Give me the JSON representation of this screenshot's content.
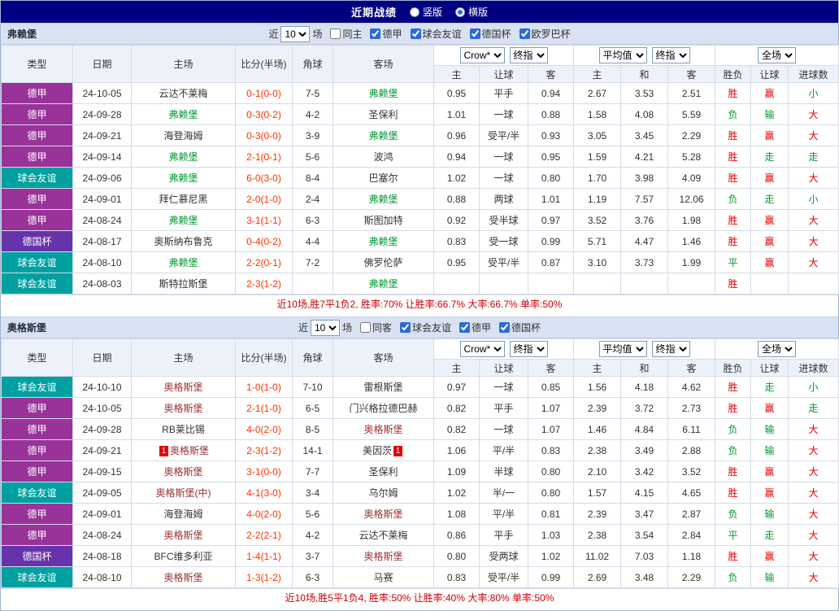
{
  "topbar": {
    "title": "近期战绩",
    "options": [
      {
        "label": "竖版",
        "selected": false
      },
      {
        "label": "横版",
        "selected": true
      }
    ]
  },
  "colors": {
    "topbar_bg": "#000080",
    "win": "#e60000",
    "loss": "#009933",
    "score": "#ff3300",
    "summary": "#cc0000",
    "league": {
      "德甲": "#993399",
      "球会友谊": "#00a0a0",
      "德国杯": "#6633aa"
    }
  },
  "result_win_values": [
    "胜",
    "赢",
    "大"
  ],
  "columns": {
    "main": [
      "类型",
      "日期",
      "主场",
      "比分(半场)",
      "角球",
      "客场"
    ],
    "asia_sub": [
      "主",
      "让球",
      "客"
    ],
    "europe_sub": [
      "主",
      "和",
      "客"
    ],
    "result_sub": [
      "胜负",
      "让球",
      "进球数"
    ]
  },
  "sections": [
    {
      "team": "弗赖堡",
      "focus_color": "#009933",
      "filter": {
        "recent_prefix": "近",
        "recent_count": "10",
        "recent_suffix": "场",
        "checkboxes": [
          {
            "label": "同主",
            "checked": false
          },
          {
            "label": "德甲",
            "checked": true
          },
          {
            "label": "球会友谊",
            "checked": true
          },
          {
            "label": "德国杯",
            "checked": true
          },
          {
            "label": "欧罗巴杯",
            "checked": true
          }
        ]
      },
      "dropdowns": {
        "asia": [
          "Crow*",
          "终指"
        ],
        "europe": [
          "平均值",
          "终指"
        ],
        "result": [
          "全场"
        ]
      },
      "rows": [
        {
          "league": "德甲",
          "date": "24-10-05",
          "home": "云达不莱梅",
          "home_focus": false,
          "score": "0-1(0-0)",
          "corners": "7-5",
          "away": "弗赖堡",
          "away_focus": true,
          "asia": [
            "0.95",
            "平手",
            "0.94"
          ],
          "europe": [
            "2.67",
            "3.53",
            "2.51"
          ],
          "results": [
            "胜",
            "赢",
            "小"
          ]
        },
        {
          "league": "德甲",
          "date": "24-09-28",
          "home": "弗赖堡",
          "home_focus": true,
          "score": "0-3(0-2)",
          "corners": "4-2",
          "away": "圣保利",
          "away_focus": false,
          "asia": [
            "1.01",
            "一球",
            "0.88"
          ],
          "europe": [
            "1.58",
            "4.08",
            "5.59"
          ],
          "results": [
            "负",
            "输",
            "大"
          ]
        },
        {
          "league": "德甲",
          "date": "24-09-21",
          "home": "海登海姆",
          "home_focus": false,
          "score": "0-3(0-0)",
          "corners": "3-9",
          "away": "弗赖堡",
          "away_focus": true,
          "asia": [
            "0.96",
            "受平/半",
            "0.93"
          ],
          "europe": [
            "3.05",
            "3.45",
            "2.29"
          ],
          "results": [
            "胜",
            "赢",
            "大"
          ]
        },
        {
          "league": "德甲",
          "date": "24-09-14",
          "home": "弗赖堡",
          "home_focus": true,
          "score": "2-1(0-1)",
          "corners": "5-6",
          "away": "波鸿",
          "away_focus": false,
          "asia": [
            "0.94",
            "一球",
            "0.95"
          ],
          "europe": [
            "1.59",
            "4.21",
            "5.28"
          ],
          "results": [
            "胜",
            "走",
            "走"
          ]
        },
        {
          "league": "球会友谊",
          "date": "24-09-06",
          "home": "弗赖堡",
          "home_focus": true,
          "score": "6-0(3-0)",
          "corners": "8-4",
          "away": "巴塞尔",
          "away_focus": false,
          "asia": [
            "1.02",
            "一球",
            "0.80"
          ],
          "europe": [
            "1.70",
            "3.98",
            "4.09"
          ],
          "results": [
            "胜",
            "赢",
            "大"
          ]
        },
        {
          "league": "德甲",
          "date": "24-09-01",
          "home": "拜仁慕尼黑",
          "home_focus": false,
          "score": "2-0(1-0)",
          "corners": "2-4",
          "away": "弗赖堡",
          "away_focus": true,
          "asia": [
            "0.88",
            "两球",
            "1.01"
          ],
          "europe": [
            "1.19",
            "7.57",
            "12.06"
          ],
          "results": [
            "负",
            "走",
            "小"
          ]
        },
        {
          "league": "德甲",
          "date": "24-08-24",
          "home": "弗赖堡",
          "home_focus": true,
          "score": "3-1(1-1)",
          "corners": "6-3",
          "away": "斯图加特",
          "away_focus": false,
          "asia": [
            "0.92",
            "受半球",
            "0.97"
          ],
          "europe": [
            "3.52",
            "3.76",
            "1.98"
          ],
          "results": [
            "胜",
            "赢",
            "大"
          ]
        },
        {
          "league": "德国杯",
          "date": "24-08-17",
          "home": "奥斯纳布鲁克",
          "home_focus": false,
          "score": "0-4(0-2)",
          "corners": "4-4",
          "away": "弗赖堡",
          "away_focus": true,
          "asia": [
            "0.83",
            "受一球",
            "0.99"
          ],
          "europe": [
            "5.71",
            "4.47",
            "1.46"
          ],
          "results": [
            "胜",
            "赢",
            "大"
          ]
        },
        {
          "league": "球会友谊",
          "date": "24-08-10",
          "home": "弗赖堡",
          "home_focus": true,
          "score": "2-2(0-1)",
          "corners": "7-2",
          "away": "佛罗伦萨",
          "away_focus": false,
          "asia": [
            "0.95",
            "受平/半",
            "0.87"
          ],
          "europe": [
            "3.10",
            "3.73",
            "1.99"
          ],
          "results": [
            "平",
            "赢",
            "大"
          ]
        },
        {
          "league": "球会友谊",
          "date": "24-08-03",
          "home": "斯特拉斯堡",
          "home_focus": false,
          "score": "2-3(1-2)",
          "corners": "",
          "away": "弗赖堡",
          "away_focus": true,
          "asia": [
            "",
            "",
            ""
          ],
          "europe": [
            "",
            "",
            ""
          ],
          "results": [
            "胜",
            "",
            ""
          ]
        }
      ],
      "footer": "近10场,胜7平1负2, 胜率:70% 让胜率:66.7% 大率:66.7% 单率:50%"
    },
    {
      "team": "奥格斯堡",
      "focus_color": "#993333",
      "filter": {
        "recent_prefix": "近",
        "recent_count": "10",
        "recent_suffix": "场",
        "checkboxes": [
          {
            "label": "同客",
            "checked": false
          },
          {
            "label": "球会友谊",
            "checked": true
          },
          {
            "label": "德甲",
            "checked": true
          },
          {
            "label": "德国杯",
            "checked": true
          }
        ]
      },
      "dropdowns": {
        "asia": [
          "Crow*",
          "终指"
        ],
        "europe": [
          "平均值",
          "终指"
        ],
        "result": [
          "全场"
        ]
      },
      "rows": [
        {
          "league": "球会友谊",
          "date": "24-10-10",
          "home": "奥格斯堡",
          "home_focus": true,
          "score": "1-0(1-0)",
          "corners": "7-10",
          "away": "雷根斯堡",
          "away_focus": false,
          "asia": [
            "0.97",
            "一球",
            "0.85"
          ],
          "europe": [
            "1.56",
            "4.18",
            "4.62"
          ],
          "results": [
            "胜",
            "走",
            "小"
          ]
        },
        {
          "league": "德甲",
          "date": "24-10-05",
          "home": "奥格斯堡",
          "home_focus": true,
          "score": "2-1(1-0)",
          "corners": "6-5",
          "away": "门兴格拉德巴赫",
          "away_focus": false,
          "asia": [
            "0.82",
            "平手",
            "1.07"
          ],
          "europe": [
            "2.39",
            "3.72",
            "2.73"
          ],
          "results": [
            "胜",
            "赢",
            "走"
          ]
        },
        {
          "league": "德甲",
          "date": "24-09-28",
          "home": "RB莱比锡",
          "home_focus": false,
          "score": "4-0(2-0)",
          "corners": "8-5",
          "away": "奥格斯堡",
          "away_focus": true,
          "asia": [
            "0.82",
            "一球",
            "1.07"
          ],
          "europe": [
            "1.46",
            "4.84",
            "6.11"
          ],
          "results": [
            "负",
            "输",
            "大"
          ]
        },
        {
          "league": "德甲",
          "date": "24-09-21",
          "home": "奥格斯堡",
          "home_focus": true,
          "home_badge": "1",
          "score": "2-3(1-2)",
          "corners": "14-1",
          "away": "美因茨",
          "away_focus": false,
          "away_badge": "1",
          "asia": [
            "1.06",
            "平/半",
            "0.83"
          ],
          "europe": [
            "2.38",
            "3.49",
            "2.88"
          ],
          "results": [
            "负",
            "输",
            "大"
          ]
        },
        {
          "league": "德甲",
          "date": "24-09-15",
          "home": "奥格斯堡",
          "home_focus": true,
          "score": "3-1(0-0)",
          "corners": "7-7",
          "away": "圣保利",
          "away_focus": false,
          "asia": [
            "1.09",
            "半球",
            "0.80"
          ],
          "europe": [
            "2.10",
            "3.42",
            "3.52"
          ],
          "results": [
            "胜",
            "赢",
            "大"
          ]
        },
        {
          "league": "球会友谊",
          "date": "24-09-05",
          "home": "奥格斯堡(中)",
          "home_focus": true,
          "score": "4-1(3-0)",
          "corners": "3-4",
          "away": "乌尔姆",
          "away_focus": false,
          "asia": [
            "1.02",
            "半/一",
            "0.80"
          ],
          "europe": [
            "1.57",
            "4.15",
            "4.65"
          ],
          "results": [
            "胜",
            "赢",
            "大"
          ]
        },
        {
          "league": "德甲",
          "date": "24-09-01",
          "home": "海登海姆",
          "home_focus": false,
          "score": "4-0(2-0)",
          "corners": "5-6",
          "away": "奥格斯堡",
          "away_focus": true,
          "asia": [
            "1.08",
            "平/半",
            "0.81"
          ],
          "europe": [
            "2.39",
            "3.47",
            "2.87"
          ],
          "results": [
            "负",
            "输",
            "大"
          ]
        },
        {
          "league": "德甲",
          "date": "24-08-24",
          "home": "奥格斯堡",
          "home_focus": true,
          "score": "2-2(2-1)",
          "corners": "4-2",
          "away": "云达不莱梅",
          "away_focus": false,
          "asia": [
            "0.86",
            "平手",
            "1.03"
          ],
          "europe": [
            "2.38",
            "3.54",
            "2.84"
          ],
          "results": [
            "平",
            "走",
            "大"
          ]
        },
        {
          "league": "德国杯",
          "date": "24-08-18",
          "home": "BFC维多利亚",
          "home_focus": false,
          "score": "1-4(1-1)",
          "corners": "3-7",
          "away": "奥格斯堡",
          "away_focus": true,
          "asia": [
            "0.80",
            "受两球",
            "1.02"
          ],
          "europe": [
            "11.02",
            "7.03",
            "1.18"
          ],
          "results": [
            "胜",
            "赢",
            "大"
          ]
        },
        {
          "league": "球会友谊",
          "date": "24-08-10",
          "home": "奥格斯堡",
          "home_focus": true,
          "score": "1-3(1-2)",
          "corners": "6-3",
          "away": "马赛",
          "away_focus": false,
          "asia": [
            "0.83",
            "受平/半",
            "0.99"
          ],
          "europe": [
            "2.69",
            "3.48",
            "2.29"
          ],
          "results": [
            "负",
            "输",
            "大"
          ]
        }
      ],
      "footer": "近10场,胜5平1负4, 胜率:50% 让胜率:40% 大率:80% 单率:50%"
    }
  ]
}
